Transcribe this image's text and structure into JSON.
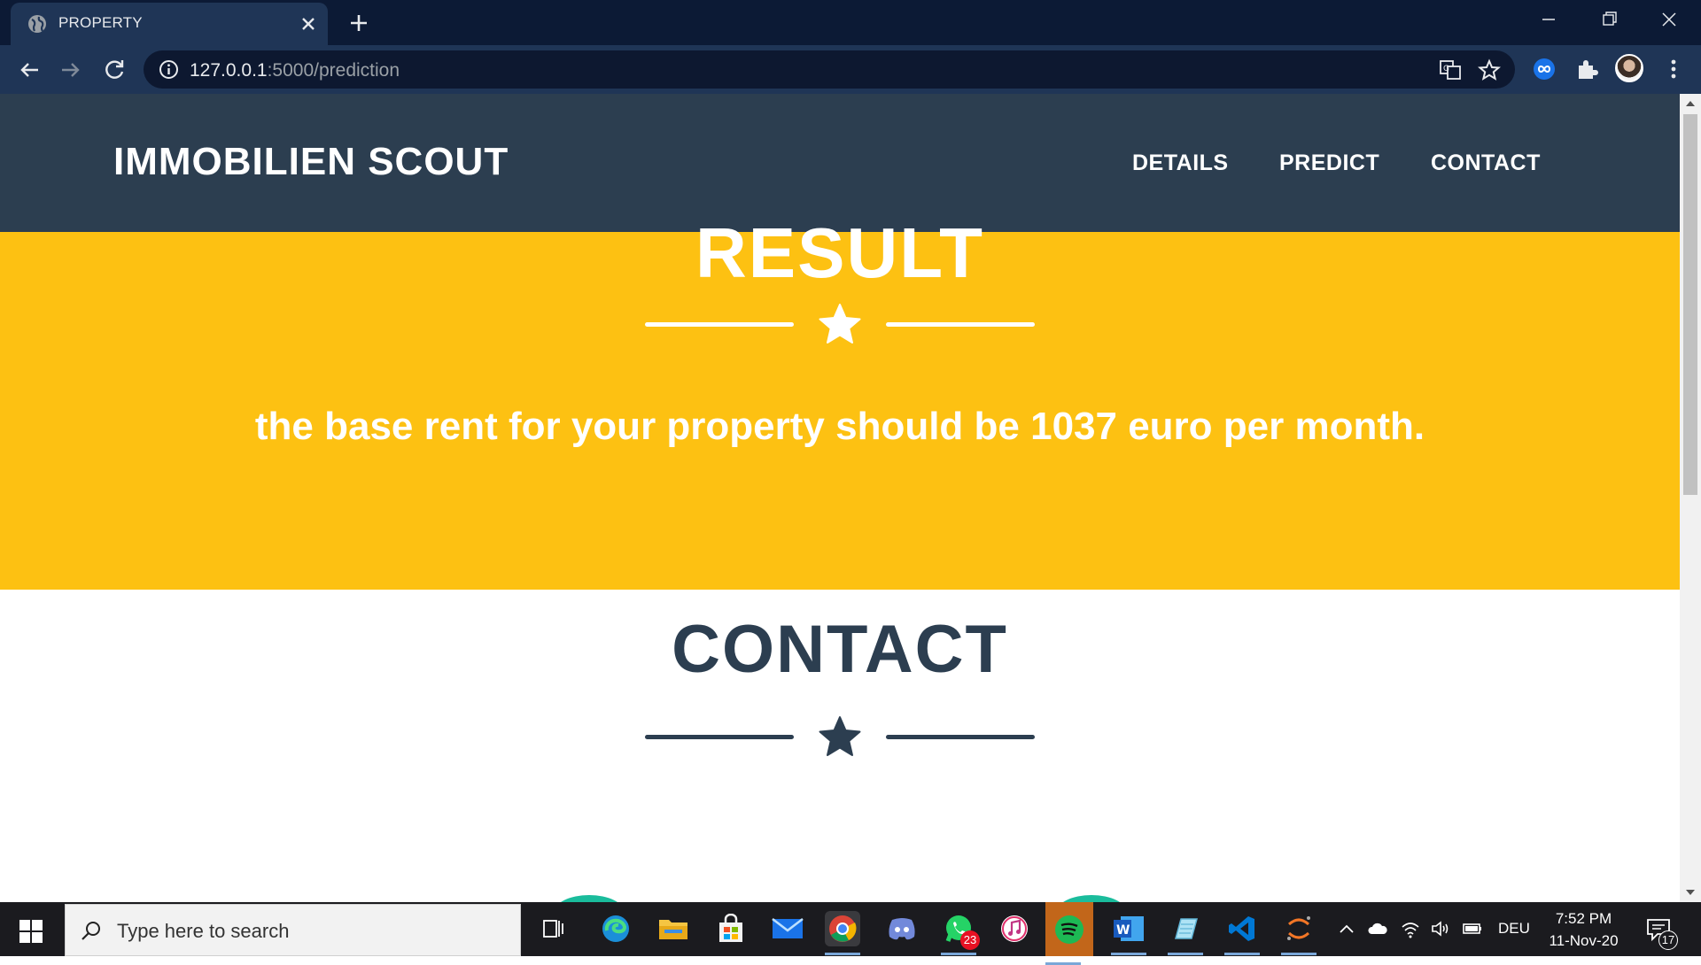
{
  "browser": {
    "tab_title": "PROPERTY",
    "url_host": "127.0.0.1",
    "url_path": ":5000/prediction"
  },
  "site": {
    "brand": "IMMOBILIEN SCOUT",
    "nav": [
      "DETAILS",
      "PREDICT",
      "CONTACT"
    ]
  },
  "result": {
    "title": "RESULT",
    "text": "the base rent for your property should be 1037 euro per month."
  },
  "contact": {
    "title": "CONTACT"
  },
  "colors": {
    "navbar": "#2c3e50",
    "result_bg": "#fdc112",
    "accent_teal": "#1abc9c",
    "text_white": "#ffffff"
  },
  "taskbar": {
    "search_placeholder": "Type here to search",
    "whatsapp_badge": "23",
    "language": "DEU",
    "time": "7:52 PM",
    "date": "11-Nov-20",
    "notification_count": "17",
    "apps": [
      "task-view-icon",
      "edge-icon",
      "file-explorer-icon",
      "store-icon",
      "mail-icon",
      "chrome-icon",
      "discord-icon",
      "whatsapp-icon",
      "itunes-icon",
      "spotify-icon",
      "word-icon",
      "notepad-icon",
      "vscode-icon",
      "jupyter-icon"
    ]
  }
}
